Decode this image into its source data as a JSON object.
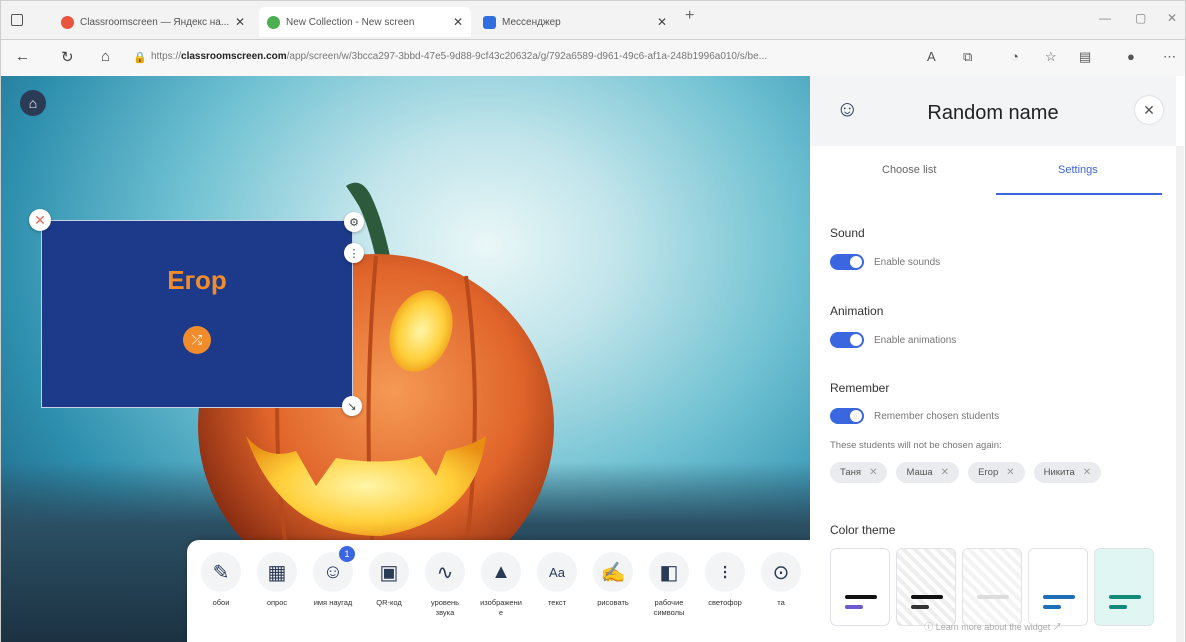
{
  "browser": {
    "tabs": [
      {
        "title": "Classroomscreen — Яндекс на...",
        "color": "#e8553f"
      },
      {
        "title": "New Collection - New screen",
        "color": "#4caf50"
      },
      {
        "title": "Мессенджер",
        "color": "#2f6fe0"
      }
    ],
    "url_prefix": "https://",
    "url_domain": "classroomscreen.com",
    "url_rest": "/app/screen/w/3bcca297-3bbd-47e5-9d88-9cf43c20632a/g/792a6589-d961-49c6-af1a-248b1996a010/s/be..."
  },
  "widget": {
    "name": "Егор"
  },
  "toolbar": {
    "tools": [
      {
        "label": "обои",
        "icon": "✎"
      },
      {
        "label": "опрос",
        "icon": "▦"
      },
      {
        "label": "имя наугад",
        "icon": "☺",
        "badge": "1"
      },
      {
        "label": "QR-код",
        "icon": "▣"
      },
      {
        "label": "уровень звука",
        "icon": "∿"
      },
      {
        "label": "изображение",
        "icon": "▲"
      },
      {
        "label": "текст",
        "icon": "Aa"
      },
      {
        "label": "рисовать",
        "icon": "✍"
      },
      {
        "label": "рабочие символы",
        "icon": "◧"
      },
      {
        "label": "светофор",
        "icon": "⁝"
      },
      {
        "label": "та",
        "icon": "⊙"
      }
    ]
  },
  "panel": {
    "title": "Random name",
    "tab_choose": "Choose list",
    "tab_settings": "Settings",
    "sound_title": "Sound",
    "sound_label": "Enable sounds",
    "animation_title": "Animation",
    "animation_label": "Enable animations",
    "remember_title": "Remember",
    "remember_label": "Remember chosen students",
    "remember_hint": "These students will not be chosen again:",
    "chips": [
      "Таня",
      "Маша",
      "Егор",
      "Никита"
    ],
    "color_title": "Color theme",
    "footer": "Learn more about the widget ↗"
  },
  "colors": {
    "accent": "#3a66e0",
    "card_bg": "#1d3a8a",
    "name_color": "#f08c2c"
  }
}
